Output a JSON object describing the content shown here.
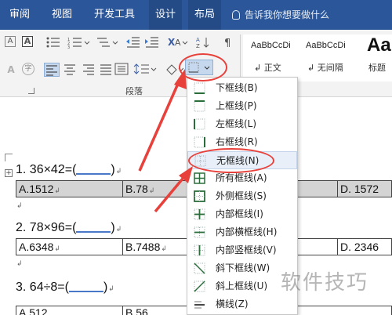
{
  "tabs": [
    "审阅",
    "视图",
    "开发工具",
    "设计",
    "布局"
  ],
  "tell_me": "告诉我你想要做什么",
  "ribbon": {
    "group_label": "段落",
    "styles": [
      {
        "preview": "AaBbCcDi",
        "name": "↲ 正文"
      },
      {
        "preview": "AaBbCcDi",
        "name": "↲ 无间隔"
      },
      {
        "preview": "AaB",
        "name": "标题"
      }
    ],
    "left_label_a": "A"
  },
  "document": {
    "questions": [
      {
        "text": "1.   36×42=(",
        "close": ")"
      },
      {
        "text": "2.   78×96=(",
        "close": ")"
      },
      {
        "text": "3.   64÷8=(",
        "close": ")"
      }
    ],
    "rows": [
      [
        "A.1512",
        "B.78",
        "",
        "D.  1572"
      ],
      [
        "A.6348",
        "B.7488",
        "",
        "D.  2346"
      ],
      [
        "A.512",
        "B.56",
        "",
        ""
      ]
    ]
  },
  "menu": {
    "items": [
      "下框线(B)",
      "上框线(P)",
      "左框线(L)",
      "右框线(R)",
      "无框线(N)",
      "所有框线(A)",
      "外侧框线(S)",
      "内部框线(I)",
      "内部横框线(H)",
      "内部竖框线(V)",
      "斜下框线(W)",
      "斜上框线(U)",
      "横线(Z)"
    ],
    "highlighted_index": 4
  },
  "watermark": "软件技巧",
  "colors": {
    "tab_bar": "#2b579a",
    "annotation": "#e8403a",
    "menu_highlight": "#e8eff8"
  }
}
